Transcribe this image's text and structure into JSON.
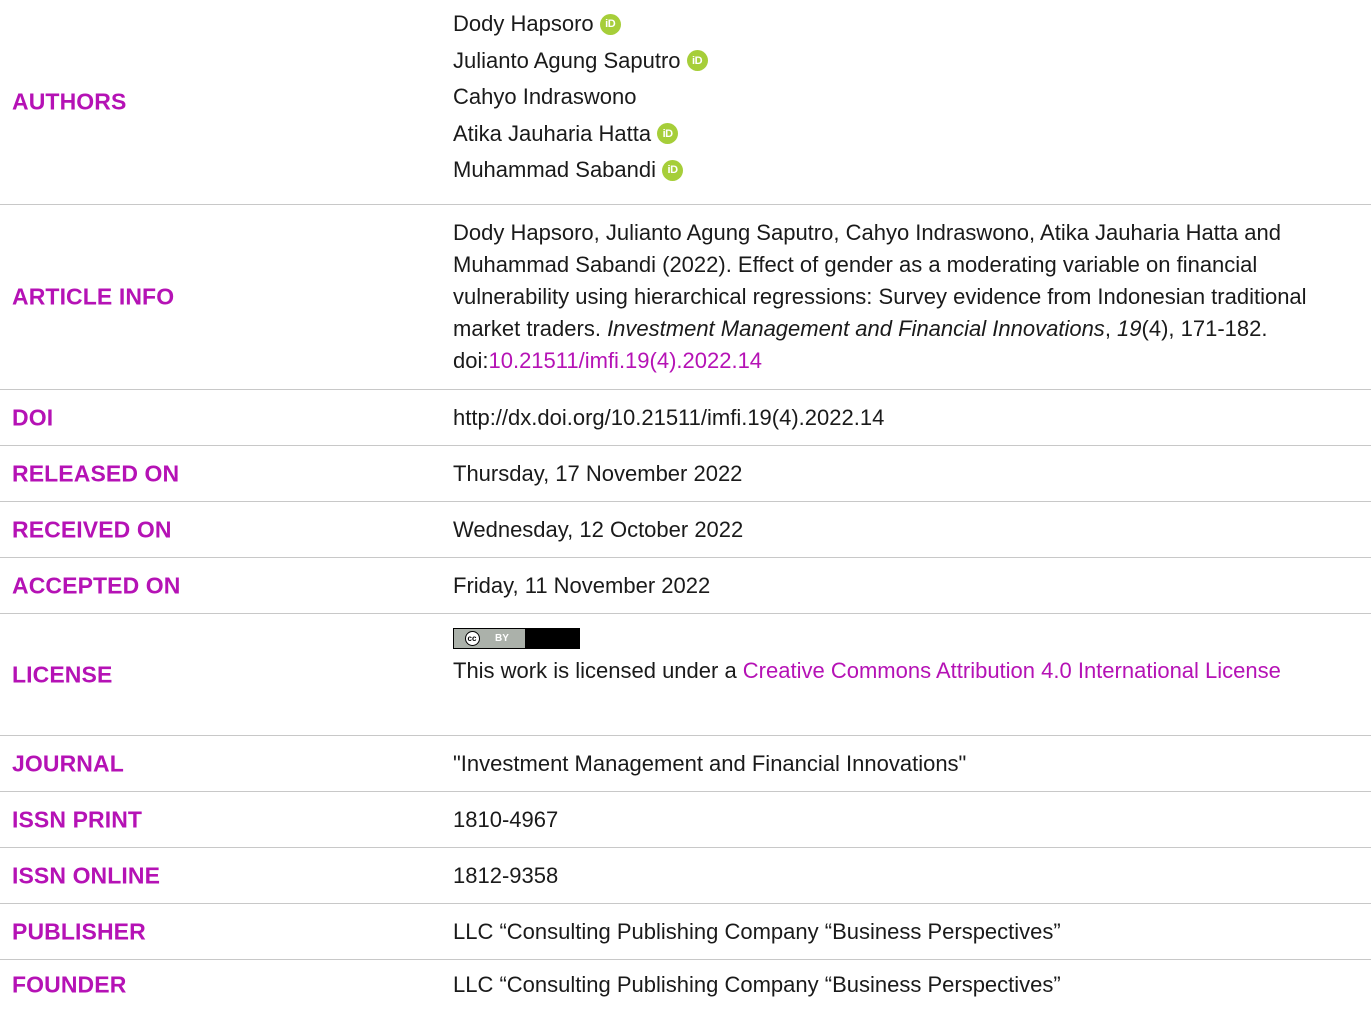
{
  "rows": {
    "authors": {
      "label": "AUTHORS",
      "names": [
        "Dody Hapsoro",
        "Julianto Agung Saputro",
        "Cahyo Indraswono",
        "Atika Jauharia Hatta",
        "Muhammad Sabandi"
      ],
      "orcid_text": "iD"
    },
    "article_info": {
      "label": "ARTICLE INFO",
      "text": "Dody Hapsoro, Julianto Agung Saputro, Cahyo Indraswono, Atika Jauharia Hatta and Muhammad Sabandi (2022). Effect of gender as a moderating variable on financial vulnerability using hierarchical regressions: Survey evidence from Indonesian traditional market traders.",
      "journal_italic": "Investment Management and Financial Innovations",
      "sep1": ", ",
      "volume_italic": "19",
      "issue_pages": "(4), 171-182. doi:",
      "doi_link": "10.21511/imfi.19(4).2022.14"
    },
    "doi": {
      "label": "DOI",
      "value": "http://dx.doi.org/10.21511/imfi.19(4).2022.14"
    },
    "released": {
      "label": "RELEASED ON",
      "value": "Thursday, 17 November 2022"
    },
    "received": {
      "label": "RECEIVED ON",
      "value": "Wednesday, 12 October 2022"
    },
    "accepted": {
      "label": "ACCEPTED ON",
      "value": "Friday, 11 November 2022"
    },
    "license": {
      "label": "LICENSE",
      "badge_cc": "cc",
      "badge_by": "BY",
      "text": "This work is licensed under a ",
      "link": "Creative Commons Attribution 4.0 International License"
    },
    "journal": {
      "label": "JOURNAL",
      "value": "\"Investment Management and Financial Innovations\""
    },
    "issn_print": {
      "label": "ISSN PRINT",
      "value": "1810-4967"
    },
    "issn_online": {
      "label": "ISSN ONLINE",
      "value": "1812-9358"
    },
    "publisher": {
      "label": "PUBLISHER",
      "value": "LLC “Consulting Publishing Company “Business Perspectives”"
    },
    "founder": {
      "label": "FOUNDER",
      "value": "LLC “Consulting Publishing Company “Business Perspectives”"
    }
  },
  "colors": {
    "label": "#b512b5",
    "link": "#b512b5",
    "text": "#1a1a1a",
    "divider": "#c8c8c8",
    "orcid": "#a6ce39"
  }
}
